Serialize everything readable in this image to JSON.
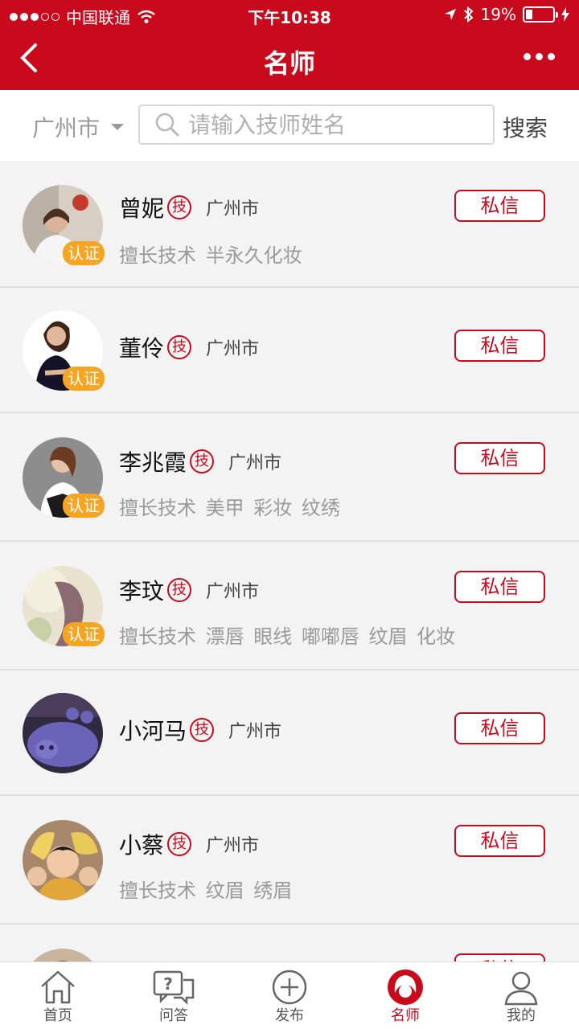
{
  "status_bar": {
    "carrier": "中国联通",
    "time": "下午10:38",
    "battery": "19%"
  },
  "nav": {
    "title": "名师"
  },
  "search": {
    "city": "广州市",
    "placeholder": "请输入技师姓名",
    "button": "搜索"
  },
  "labels": {
    "cert": "认证",
    "badge": "技",
    "message": "私信"
  },
  "masters": [
    {
      "name": "曾妮",
      "city": "广州市",
      "skills": "擅长技术 半永久化妆",
      "certified": true
    },
    {
      "name": "董伶",
      "city": "广州市",
      "skills": "",
      "certified": true
    },
    {
      "name": "李兆霞",
      "city": "广州市",
      "skills": "擅长技术 美甲 彩妆 纹绣",
      "certified": true
    },
    {
      "name": "李玟",
      "city": "广州市",
      "skills": "擅长技术 漂唇 眼线 嘟嘟唇 纹眉 化妆",
      "certified": true
    },
    {
      "name": "小河马",
      "city": "广州市",
      "skills": "",
      "certified": false
    },
    {
      "name": "小蔡",
      "city": "广州市",
      "skills": "擅长技术 纹眉 绣眉",
      "certified": false
    }
  ],
  "tabs": [
    {
      "label": "首页",
      "icon": "home-icon"
    },
    {
      "label": "问答",
      "icon": "qa-icon"
    },
    {
      "label": "发布",
      "icon": "publish-icon"
    },
    {
      "label": "名师",
      "icon": "master-icon",
      "active": true
    },
    {
      "label": "我的",
      "icon": "profile-icon"
    }
  ],
  "colors": {
    "brand": "#c9091c",
    "cert": "#f5a522"
  }
}
